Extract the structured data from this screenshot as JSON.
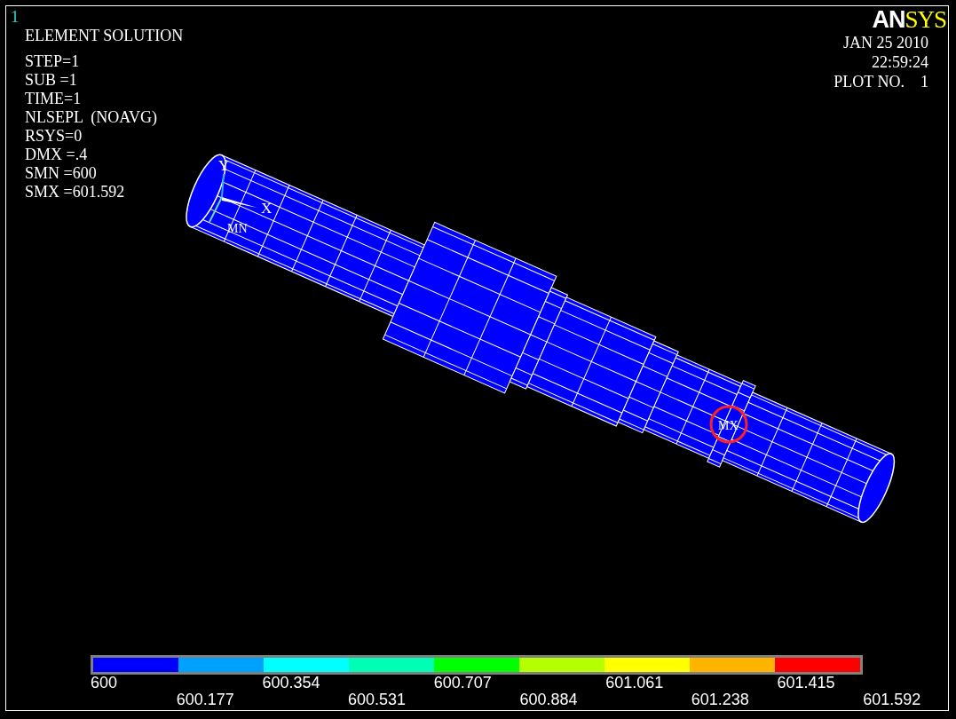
{
  "window_number": "1",
  "title": "ELEMENT SOLUTION",
  "info_lines": [
    "STEP=1",
    "SUB =1",
    "TIME=1",
    "NLSEPL  (NOAVG)",
    "RSYS=0",
    "DMX =.4",
    "SMN =600",
    "SMX =601.592"
  ],
  "logo": {
    "first": "AN",
    "second": "SYS"
  },
  "stamp": [
    "JAN 25 2010",
    "22:59:24",
    "PLOT NO.    1"
  ],
  "triad": {
    "y_label": "Y",
    "x_label": "X"
  },
  "min_label": "MN",
  "max_label": "MX",
  "legend": {
    "colors": [
      {
        "color": "#0000ff"
      },
      {
        "color": "#00a0ff"
      },
      {
        "color": "#00ffff"
      },
      {
        "color": "#00ffb4"
      },
      {
        "color": "#00ff00"
      },
      {
        "color": "#b4ff00"
      },
      {
        "color": "#ffff00"
      },
      {
        "color": "#ffb400"
      },
      {
        "color": "#ff0000"
      }
    ],
    "labels": [
      "600",
      "600.177",
      "600.354",
      "600.531",
      "600.707",
      "600.884",
      "601.061",
      "601.238",
      "601.415",
      "601.592"
    ]
  }
}
